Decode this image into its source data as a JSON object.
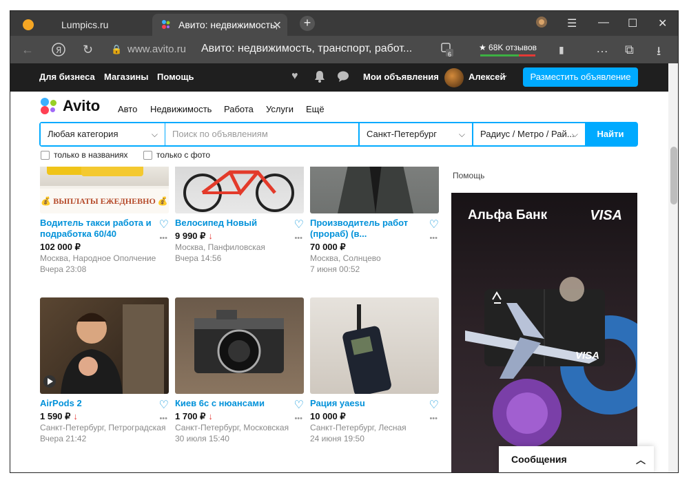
{
  "browser": {
    "tabs": [
      {
        "label": "Lumpics.ru"
      },
      {
        "label": "Авито: недвижимость,"
      }
    ],
    "url_host": "www.avito.ru",
    "page_title": "Авито: недвижимость, транспорт, работ...",
    "reviews": "★ 68K отзывов",
    "ext_badge": "6"
  },
  "topbar": {
    "links": [
      "Для бизнеса",
      "Магазины",
      "Помощь"
    ],
    "my_ads": "Мои объявления",
    "user": "Алексей",
    "post_button": "Разместить объявление"
  },
  "header": {
    "logo": "Avito",
    "menu": [
      "Авто",
      "Недвижимость",
      "Работа",
      "Услуги",
      "Ещё"
    ]
  },
  "search": {
    "category": "Любая категория",
    "placeholder": "Поиск по объявлениям",
    "city": "Санкт-Петербург",
    "radius": "Радиус / Метро / Рай...",
    "button": "Найти",
    "check_titles": "только в названиях",
    "check_photo": "только с фото"
  },
  "sidebar": {
    "help": "Помощь",
    "ad_bank": "Альфа Банк",
    "ad_visa": "VISA",
    "card_visa": "VISA"
  },
  "banner_text": "💰 ВЫПЛАТЫ ЕЖЕДНЕВНО 💰",
  "listings": [
    {
      "title": "Водитель такси работа и подработка 60/40",
      "price": "102 000 ₽",
      "drop": false,
      "loc": "Москва, Народное Ополчение",
      "time": "Вчера 23:08"
    },
    {
      "title": "Велосипед Новый",
      "price": "9 990 ₽",
      "drop": true,
      "loc": "Москва, Панфиловская",
      "time": "Вчера 14:56"
    },
    {
      "title": "Производитель работ (прораб) (в...",
      "price": "70 000 ₽",
      "drop": false,
      "loc": "Москва, Солнцево",
      "time": "7 июня 00:52"
    },
    {
      "title": "AirPods 2",
      "price": "1 590 ₽",
      "drop": true,
      "loc": "Санкт-Петербург, Петроградская",
      "time": "Вчера 21:42"
    },
    {
      "title": "Киев 6с с нюансами",
      "price": "1 700 ₽",
      "drop": true,
      "loc": "Санкт-Петербург, Московская",
      "time": "30 июля 15:40"
    },
    {
      "title": "Рация yaesu",
      "price": "10 000 ₽",
      "drop": false,
      "loc": "Санкт-Петербург, Лесная",
      "time": "24 июня 19:50"
    }
  ],
  "messages": "Сообщения"
}
